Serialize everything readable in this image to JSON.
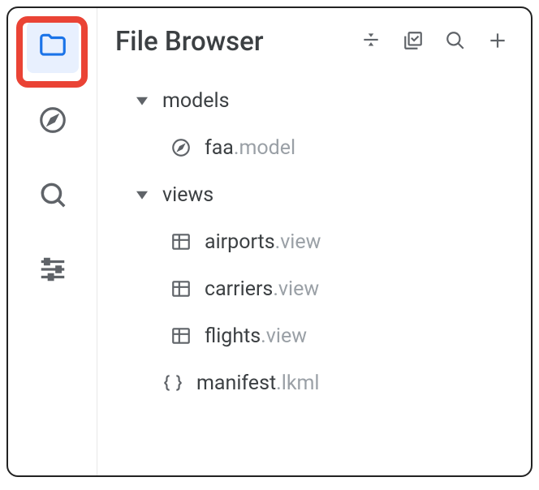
{
  "header": {
    "title": "File Browser"
  },
  "sidebar": {
    "items": [
      {
        "name": "file-browser",
        "icon": "folder-icon",
        "active": true
      },
      {
        "name": "object-browser",
        "icon": "compass-icon",
        "active": false
      },
      {
        "name": "git-history",
        "icon": "history-icon",
        "active": false
      },
      {
        "name": "settings",
        "icon": "sliders-icon",
        "active": false
      }
    ]
  },
  "toolbar": {
    "collapse": "collapse",
    "bulk": "bulk-check",
    "search": "search",
    "add": "add"
  },
  "tree": [
    {
      "type": "folder",
      "label": "models",
      "indent": 0,
      "expanded": true
    },
    {
      "type": "file",
      "name": "faa",
      "ext": ".model",
      "icon": "compass",
      "indent": 1
    },
    {
      "type": "folder",
      "label": "views",
      "indent": 0,
      "expanded": true
    },
    {
      "type": "file",
      "name": "airports",
      "ext": ".view",
      "icon": "table",
      "indent": 1
    },
    {
      "type": "file",
      "name": "carriers",
      "ext": ".view",
      "icon": "table",
      "indent": 1
    },
    {
      "type": "file",
      "name": "flights",
      "ext": ".view",
      "icon": "table",
      "indent": 1
    },
    {
      "type": "file",
      "name": "manifest",
      "ext": ".lkml",
      "icon": "braces",
      "indent": 0
    }
  ]
}
